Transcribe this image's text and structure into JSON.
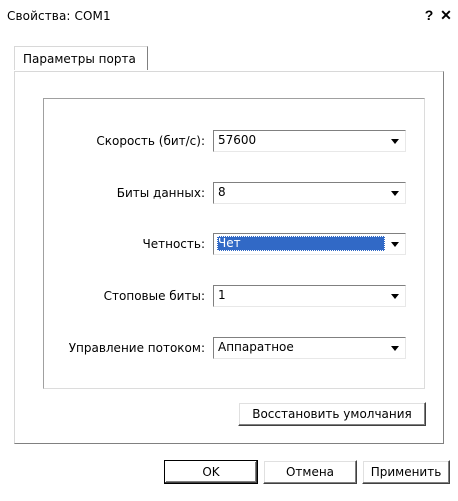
{
  "window": {
    "title": "Свойства: COM1",
    "help_label": "?",
    "close_label": "✕"
  },
  "tabs": [
    {
      "label": "Параметры порта",
      "active": true
    }
  ],
  "settings": [
    {
      "label": "Скорость (бит/с):",
      "value": "57600",
      "focused": false
    },
    {
      "label": "Биты данных:",
      "value": "8",
      "focused": false
    },
    {
      "label": "Четность:",
      "value": "Чет",
      "focused": true
    },
    {
      "label": "Стоповые биты:",
      "value": "1",
      "focused": false
    },
    {
      "label": "Управление потоком:",
      "value": "Аппаратное",
      "focused": false
    }
  ],
  "restore_defaults_label": "Восстановить умолчания",
  "footer": {
    "ok_label": "OK",
    "cancel_label": "Отмена",
    "apply_label": "Применить"
  },
  "colors": {
    "selection": "#3169c6"
  }
}
